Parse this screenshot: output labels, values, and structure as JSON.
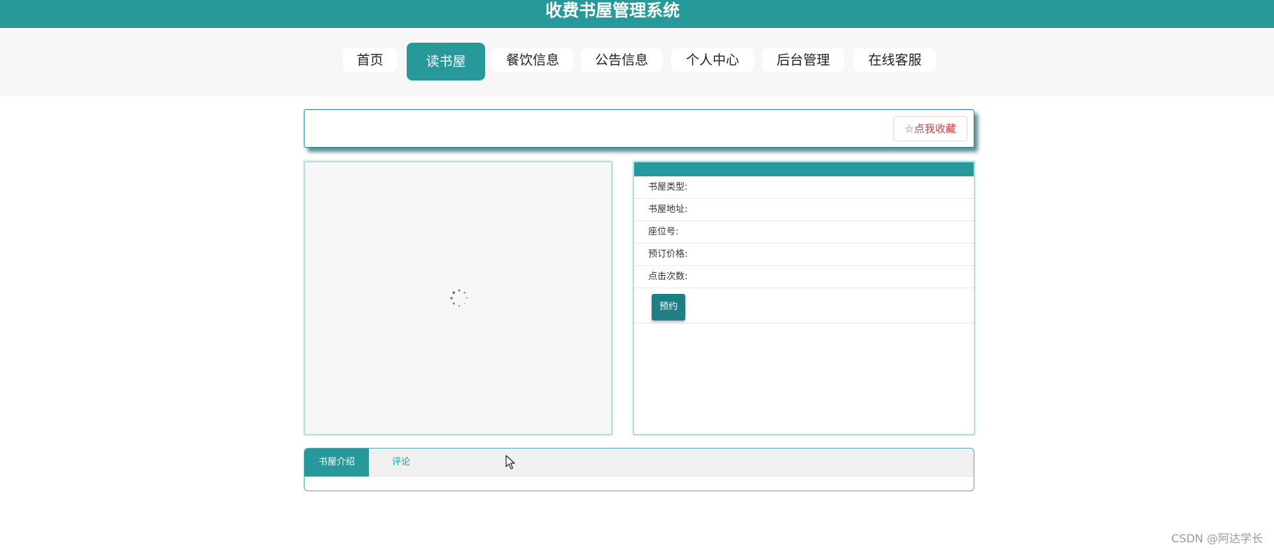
{
  "header": {
    "title": "收费书屋管理系统"
  },
  "nav": {
    "items": [
      {
        "label": "首页"
      },
      {
        "label": "读书屋"
      },
      {
        "label": "餐饮信息"
      },
      {
        "label": "公告信息"
      },
      {
        "label": "个人中心"
      },
      {
        "label": "后台管理"
      },
      {
        "label": "在线客服"
      }
    ],
    "active": "读书屋"
  },
  "favorite": {
    "icon": "star-outline-icon",
    "label": "点我收藏"
  },
  "image_panel": {
    "state": "loading",
    "icon": "loading-spinner-icon"
  },
  "details": {
    "fields": [
      {
        "label": "书屋类型:",
        "value": ""
      },
      {
        "label": "书屋地址:",
        "value": ""
      },
      {
        "label": "座位号:",
        "value": ""
      },
      {
        "label": "预订价格:",
        "value": ""
      },
      {
        "label": "点击次数:",
        "value": ""
      }
    ],
    "book_button": "预约"
  },
  "tabs": {
    "items": [
      {
        "label": "书屋介绍"
      },
      {
        "label": "评论"
      }
    ],
    "active": "书屋介绍"
  },
  "watermark": "CSDN @阿达学长",
  "colors": {
    "primary": "#27999b",
    "button_dark": "#1e7f85",
    "favorite_red": "#d43c3c",
    "nav_bg": "#f7f7f7"
  }
}
